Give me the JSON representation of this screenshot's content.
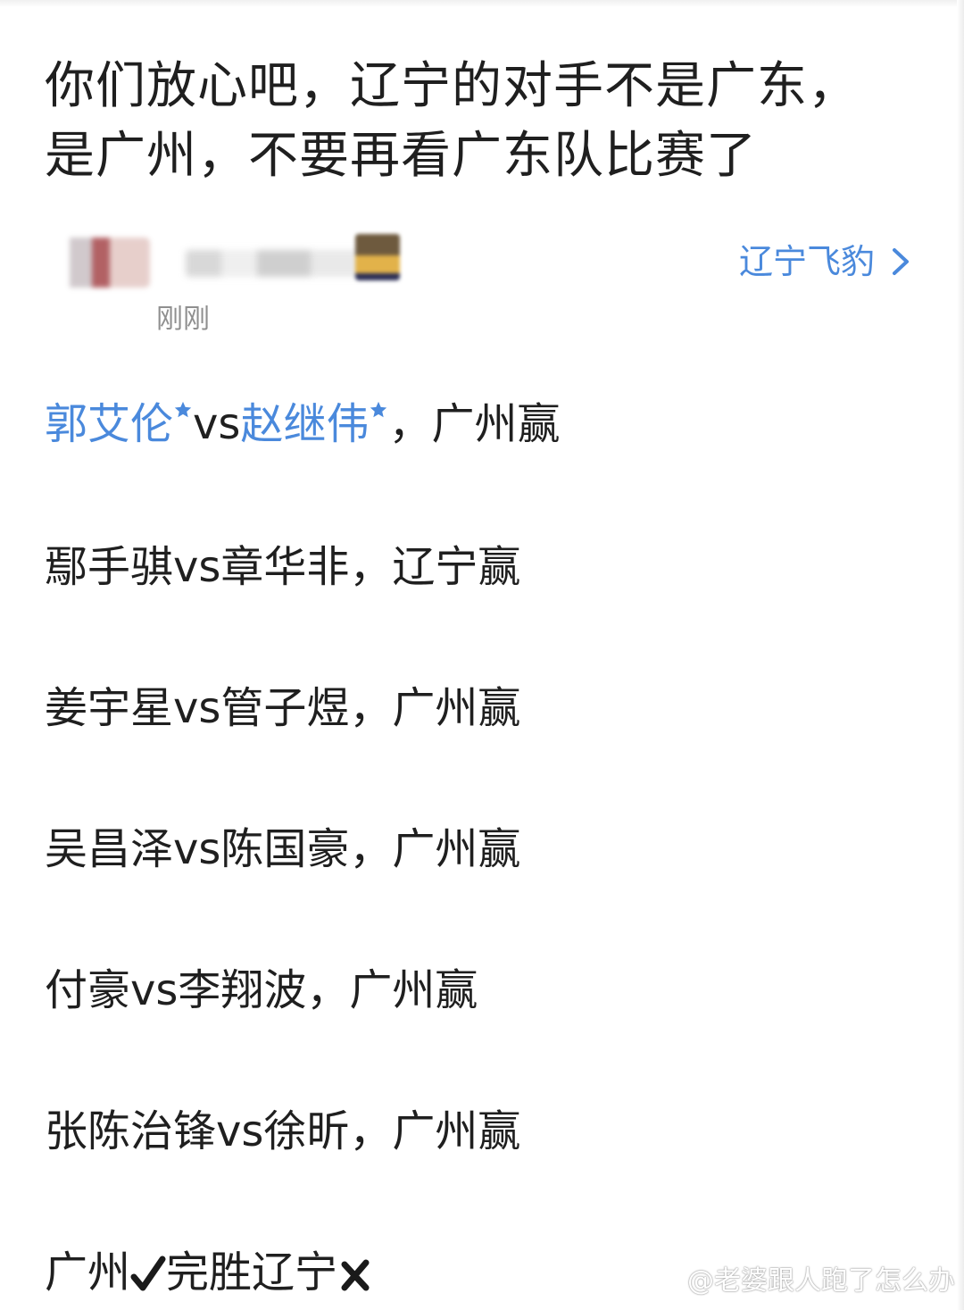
{
  "post": {
    "title": "你们放心吧，辽宁的对手不是广东，是广州，不要再看广东队比赛了",
    "timestamp": "刚刚",
    "topic": "辽宁飞豹"
  },
  "colors": {
    "link": "#4a89dc",
    "text": "#1f1f1f",
    "muted": "#8f8f8f"
  },
  "matchups": [
    {
      "player_a": "郭艾伦",
      "vs": "vs",
      "player_b": "赵继伟",
      "result": "，广州赢",
      "highlighted": true
    },
    {
      "text": "鄢手骐vs章华非，辽宁赢"
    },
    {
      "text": "姜宇星vs管子煜，广州赢"
    },
    {
      "text": "吴昌泽vs陈国豪，广州赢"
    },
    {
      "text": "付豪vs李翔波，广州赢"
    },
    {
      "text": "张陈治锋vs徐昕，广州赢"
    }
  ],
  "summary": {
    "team_a": "广州",
    "mark_a": "check-icon",
    "middle": "完胜辽宁",
    "mark_b": "cross-icon"
  },
  "watermark": {
    "text": "@老婆跟人跑了怎么办",
    "icon": "weibo-icon"
  }
}
